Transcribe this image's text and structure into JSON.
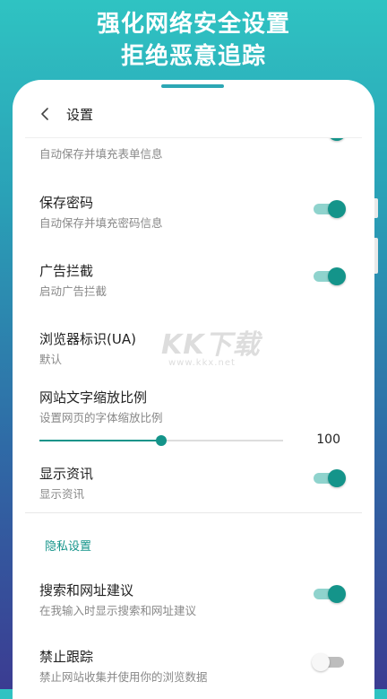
{
  "banner": {
    "line1": "强化网络安全设置",
    "line2": "拒绝恶意追踪"
  },
  "header": {
    "title": "设置"
  },
  "watermark": {
    "logo": "KK下载",
    "url": "www.kkx.net"
  },
  "colors": {
    "accent": "#14948a",
    "track_on": "#8fd3cd",
    "track_off": "#bdbdbd"
  },
  "settings": {
    "autofill": {
      "subtitle": "自动保存并填充表单信息",
      "enabled": true
    },
    "save_password": {
      "title": "保存密码",
      "subtitle": "自动保存并填充密码信息",
      "enabled": true
    },
    "ad_block": {
      "title": "广告拦截",
      "subtitle": "启动广告拦截",
      "enabled": true
    },
    "user_agent": {
      "title": "浏览器标识(UA)",
      "subtitle": "默认"
    },
    "text_zoom": {
      "title": "网站文字缩放比例",
      "subtitle": "设置网页的字体缩放比例",
      "value": "100",
      "fraction": 0.5
    },
    "show_news": {
      "title": "显示资讯",
      "subtitle": "显示资讯",
      "enabled": true
    }
  },
  "privacy": {
    "section_title": "隐私设置",
    "search_suggest": {
      "title": "搜索和网址建议",
      "subtitle": "在我输入时显示搜索和网址建议",
      "enabled": true
    },
    "do_not_track": {
      "title": "禁止跟踪",
      "subtitle": "禁止网站收集并使用你的浏览数据",
      "enabled": false
    }
  }
}
